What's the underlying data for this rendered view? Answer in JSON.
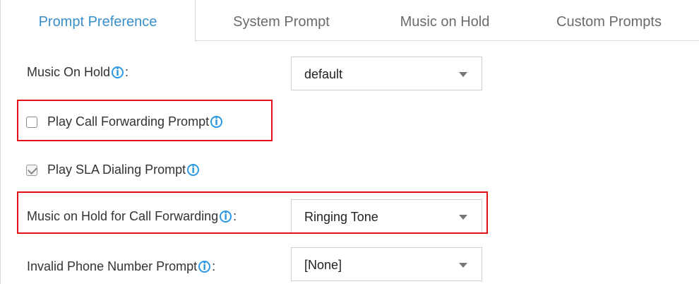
{
  "tabs": [
    {
      "label": "Prompt Preference",
      "active": true
    },
    {
      "label": "System Prompt",
      "active": false
    },
    {
      "label": "Music on Hold",
      "active": false
    },
    {
      "label": "Custom Prompts",
      "active": false
    }
  ],
  "fields": {
    "music_on_hold": {
      "label": "Music On Hold",
      "value": "default"
    },
    "play_call_forwarding": {
      "label": "Play Call Forwarding Prompt",
      "checked": false
    },
    "play_sla_dialing": {
      "label": "Play SLA Dialing Prompt",
      "checked": true
    },
    "moh_call_forwarding": {
      "label": "Music on Hold for Call Forwarding",
      "value": "Ringing Tone"
    },
    "invalid_phone": {
      "label": "Invalid Phone Number Prompt",
      "value": "[None]"
    }
  },
  "colon": ":",
  "info_glyph": "i",
  "colors": {
    "accent": "#3a8fc8",
    "info": "#2f98e2",
    "highlight": "#e2101b"
  }
}
